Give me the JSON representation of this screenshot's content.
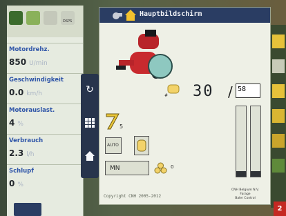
{
  "screen": {
    "title": "Hauptbildschirm",
    "copyright": "Copyright CNH 2005-2012",
    "device_info": [
      "CNH Belgium N.V.",
      "Farage",
      "Baler Control"
    ]
  },
  "left_panel": {
    "stats": [
      {
        "label": "Motordrehz.",
        "value": "850",
        "unit": "U/min"
      },
      {
        "label": "Geschwindigkeit",
        "value": "0.0",
        "unit": "km/h"
      },
      {
        "label": "Motorauslast.",
        "value": "4",
        "unit": "%"
      },
      {
        "label": "Verbrauch",
        "value": "2.3",
        "unit": "l/h"
      },
      {
        "label": "Schlupf",
        "value": "0",
        "unit": "%"
      }
    ],
    "top_label": "DSPS"
  },
  "baling": {
    "bale_count": "30",
    "target": "58",
    "knife_count": "5",
    "mode_label": "AUTO",
    "crop_label": "MN",
    "crop_count": "0"
  },
  "page_badge": "2",
  "colors": {
    "accent": "#2a3d63",
    "badge": "#c52822",
    "label": "#2f55a8"
  }
}
